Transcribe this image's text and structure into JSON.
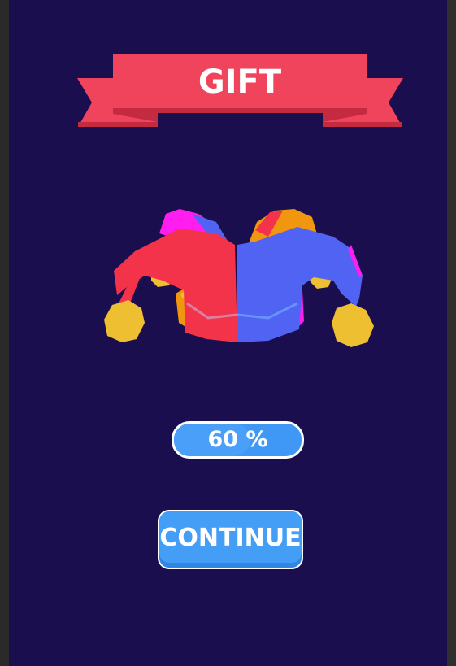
{
  "reward": {
    "title": "GIFT",
    "item_icon": "jester-hat-icon"
  },
  "progress": {
    "label": "60 %",
    "value": 0.6
  },
  "actions": {
    "continue_label": "CONTINUE"
  },
  "colors": {
    "background": "#1b0e4e",
    "ribbon": "#f0435c",
    "ribbon_shadow": "#c42a40",
    "button": "#459ef6",
    "hat_red": "#f2334a",
    "hat_blue": "#5163f2",
    "hat_magenta": "#ff1df0",
    "hat_orange": "#f0960f",
    "hat_yellow": "#eebf31"
  }
}
